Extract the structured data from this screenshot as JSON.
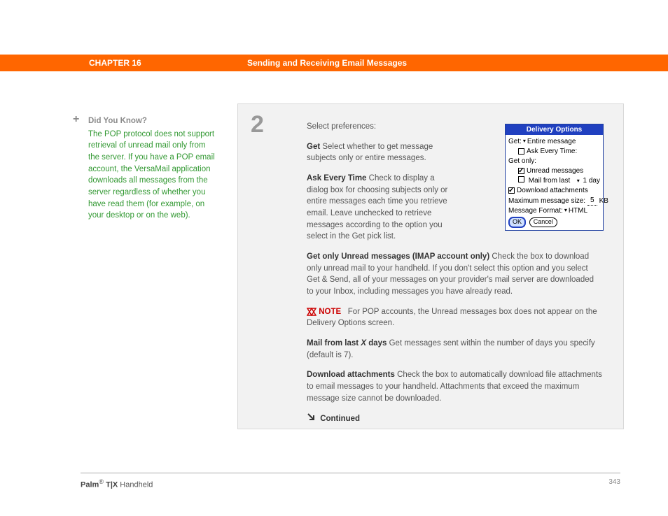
{
  "header": {
    "chapter": "CHAPTER 16",
    "title": "Sending and Receiving Email Messages"
  },
  "sidebar": {
    "dyk_title": "Did You Know?",
    "dyk_body": "The POP protocol does not support retrieval of unread mail only from the server. If you have a POP email account, the VersaMail application downloads all messages from the server regardless of whether you have read them (for example, on your desktop or on the web)."
  },
  "step": {
    "number": "2",
    "intro": "Select preferences:",
    "get_label": "Get",
    "get_text": "   Select whether to get message subjects only or entire messages.",
    "ask_label": "Ask Every Time",
    "ask_text": "   Check to display a dialog box for choosing subjects only or entire messages each time you retrieve email. Leave unchecked to retrieve messages according to the option you select in the Get pick list.",
    "unread_label": "Get only Unread messages (IMAP account only)",
    "unread_text": "   Check the box to download only unread mail to your handheld. If you don't select this option and you select Get & Send, all of your messages on your provider's mail server are downloaded to your Inbox, including messages you have already read.",
    "note_label": "NOTE",
    "note_text": "For POP accounts, the Unread messages box does not appear on the Delivery Options screen.",
    "mail_last_label": "Mail from last X days",
    "mail_last_text": "   Get messages sent within the number of days you specify (default is 7).",
    "download_label": "Download attachments",
    "download_text": "   Check the box to automatically download file attachments to email messages to your handheld. Attachments that exceed the maximum message size cannot be downloaded.",
    "continued": "Continued"
  },
  "delivery": {
    "title": "Delivery Options",
    "get_label": "Get:",
    "get_value": "Entire message",
    "ask_every": "Ask Every Time:",
    "get_only": "Get only:",
    "unread": "Unread messages",
    "mail_from_last": "Mail from last",
    "mail_days_value": "1 day",
    "download_att": "Download attachments",
    "max_size_label": "Maximum message size:",
    "max_size_value": "5",
    "max_size_unit": "KB",
    "msg_format_label": "Message Format:",
    "msg_format_value": "HTML",
    "ok": "OK",
    "cancel": "Cancel"
  },
  "footer": {
    "brand": "Palm",
    "model": " T|X",
    "suffix": " Handheld",
    "page": "343"
  }
}
